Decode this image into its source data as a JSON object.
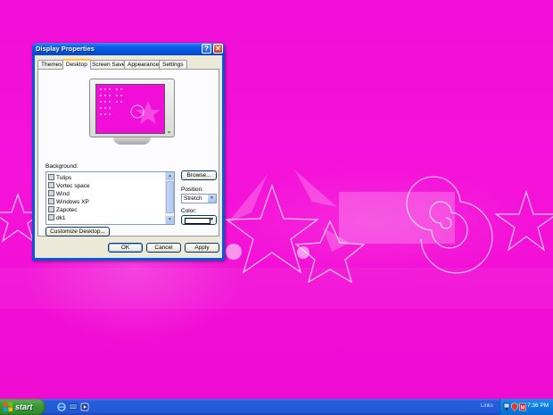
{
  "window": {
    "title": "Display Properties",
    "help_glyph": "?",
    "close_glyph": "✕"
  },
  "tabs": [
    {
      "label": "Themes"
    },
    {
      "label": "Desktop",
      "active": true
    },
    {
      "label": "Screen Saver"
    },
    {
      "label": "Appearance"
    },
    {
      "label": "Settings"
    }
  ],
  "desktop_tab": {
    "background_label": "Background:",
    "backgrounds": [
      {
        "name": "Tulips",
        "icon": "image-file-icon"
      },
      {
        "name": "Vortec space",
        "icon": "image-file-icon"
      },
      {
        "name": "Wind",
        "icon": "image-file-icon"
      },
      {
        "name": "Windows XP",
        "icon": "image-file-icon"
      },
      {
        "name": "Zapotec",
        "icon": "image-file-icon"
      },
      {
        "name": "dk1",
        "icon": "image-file-icon",
        "selected": true
      }
    ],
    "browse_label": "Browse...",
    "position_label": "Position:",
    "position_value": "Stretch",
    "color_label": "Color:",
    "color_value": "#ffffff",
    "customize_label": "Customize Desktop..."
  },
  "buttons": {
    "ok": "OK",
    "cancel": "Cancel",
    "apply": "Apply"
  },
  "taskbar": {
    "start_label": "start",
    "links_label": "Links",
    "time": "7:36 PM",
    "quick_launch": [
      "internet-explorer-icon",
      "show-desktop-icon",
      "media-player-icon"
    ],
    "tray_icons": [
      "network-icon",
      "security-alert-icon",
      "antivirus-icon"
    ]
  },
  "colors": {
    "wallpaper_pink": "#f00ed8",
    "xp_blue": "#0a54e0",
    "start_green": "#3c9a38"
  }
}
